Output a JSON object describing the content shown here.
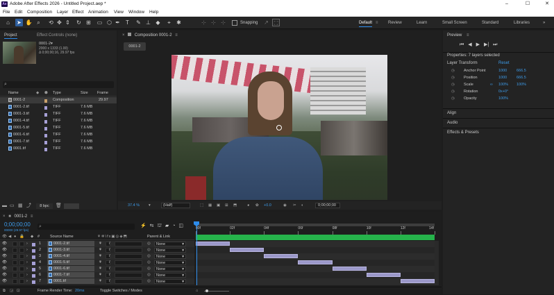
{
  "app": {
    "title": "Adobe After Effects 2026 - Untitled Project.aep *",
    "icon_text": "Ae"
  },
  "window_controls": {
    "minimize": "–",
    "maximize": "☐",
    "close": "✕"
  },
  "menu": [
    "File",
    "Edit",
    "Composition",
    "Layer",
    "Effect",
    "Animation",
    "View",
    "Window",
    "Help"
  ],
  "toolbar": {
    "snapping": "Snapping"
  },
  "workspaces": [
    "Default",
    "Review",
    "Learn",
    "Small Screen",
    "Standard",
    "Libraries"
  ],
  "project_panel": {
    "tab_project": "Project",
    "tab_effects": "Effect Controls (none)",
    "comp_name": "0001-2▾",
    "comp_size": "2000 x 1333 (1.00)",
    "comp_duration": "Δ 0;00;00;16, 29.97 fps",
    "search_placeholder": "",
    "columns": {
      "name": "Name",
      "type": "Type",
      "size": "Size",
      "frame_rate": "Frame Ra..."
    },
    "items": [
      {
        "name": "0001-2",
        "type": "Composition",
        "size": "",
        "fps": "29.97",
        "kind": "comp",
        "label_color": "#c9a06b"
      },
      {
        "name": "0001-2.tif",
        "type": "TIFF",
        "size": "7.6 MB",
        "fps": "",
        "kind": "file",
        "label_color": "#a6a0d6"
      },
      {
        "name": "0001-3.tif",
        "type": "TIFF",
        "size": "7.6 MB",
        "fps": "",
        "kind": "file",
        "label_color": "#a6a0d6"
      },
      {
        "name": "0001-4.tif",
        "type": "TIFF",
        "size": "7.6 MB",
        "fps": "",
        "kind": "file",
        "label_color": "#a6a0d6"
      },
      {
        "name": "0001-5.tif",
        "type": "TIFF",
        "size": "7.6 MB",
        "fps": "",
        "kind": "file",
        "label_color": "#a6a0d6"
      },
      {
        "name": "0001-6.tif",
        "type": "TIFF",
        "size": "7.6 MB",
        "fps": "",
        "kind": "file",
        "label_color": "#a6a0d6"
      },
      {
        "name": "0001-7.tif",
        "type": "TIFF",
        "size": "7.6 MB",
        "fps": "",
        "kind": "file",
        "label_color": "#a6a0d6"
      },
      {
        "name": "0001.tif",
        "type": "TIFF",
        "size": "7.6 MB",
        "fps": "",
        "kind": "file",
        "label_color": "#a6a0d6"
      }
    ],
    "bpc": "8 bpc"
  },
  "comp_viewer": {
    "tab": "Composition 0001-2",
    "subtab": "0001-2",
    "zoom": "37.4 %",
    "resolution": "(Half)",
    "exposure": "+0.0",
    "timecode": "0;00;00;00"
  },
  "right_panel": {
    "preview_title": "Preview",
    "properties_title": "Properties: 7 layers selected",
    "layer_transform": "Layer Transform",
    "reset": "Reset",
    "props": [
      {
        "name": "Anchor Point",
        "v1": "1000",
        "v2": "666.5",
        "link": false
      },
      {
        "name": "Position",
        "v1": "1000",
        "v2": "666.5",
        "link": false
      },
      {
        "name": "Scale",
        "v1": "100%",
        "v2": "100%",
        "link": true
      },
      {
        "name": "Rotation",
        "v1": "0x+0°",
        "v2": "",
        "link": false
      },
      {
        "name": "Opacity",
        "v1": "100%",
        "v2": "",
        "link": false
      }
    ],
    "sections": [
      "Align",
      "Audio",
      "Effects & Presets"
    ]
  },
  "timeline": {
    "tab": "0001-2",
    "timecode": "0;00;00;00",
    "timecode_sub": "00000 (29.97 fps)",
    "col_hash": "#",
    "col_source": "Source Name",
    "col_parent": "Parent & Link",
    "ruler": [
      "00f",
      "02f",
      "04f",
      "06f",
      "08f",
      "10f",
      "12f",
      "14f"
    ],
    "layers": [
      {
        "num": "1",
        "name": "0001-2.tif",
        "parent": "None",
        "bar_start": 0,
        "bar_end": 2
      },
      {
        "num": "2",
        "name": "0001-3.tif",
        "parent": "None",
        "bar_start": 2,
        "bar_end": 4
      },
      {
        "num": "3",
        "name": "0001-4.tif",
        "parent": "None",
        "bar_start": 4,
        "bar_end": 6
      },
      {
        "num": "4",
        "name": "0001-5.tif",
        "parent": "None",
        "bar_start": 6,
        "bar_end": 8
      },
      {
        "num": "5",
        "name": "0001-6.tif",
        "parent": "None",
        "bar_start": 8,
        "bar_end": 10
      },
      {
        "num": "6",
        "name": "0001-7.tif",
        "parent": "None",
        "bar_start": 10,
        "bar_end": 12
      },
      {
        "num": "7",
        "name": "0001.tif",
        "parent": "None",
        "bar_start": 12,
        "bar_end": 14
      }
    ],
    "total_frames": 14,
    "footer_render_label": "Frame Render Time:",
    "footer_render_value": "20ms",
    "footer_toggle": "Toggle Switches / Modes"
  },
  "colors": {
    "accent": "#2d8ceb",
    "blue_value": "#3d9be9",
    "layer_bar": "#9b98c9",
    "work_area": "#26b34b"
  },
  "icons": [
    "home-icon",
    "selection-arrow-icon",
    "hand-icon",
    "zoom-icon",
    "rotate-icon",
    "camera-icon",
    "pan-icon",
    "rectangle-icon",
    "pen-icon",
    "type-icon",
    "brush-icon",
    "clone-icon",
    "eraser-icon",
    "roto-icon",
    "puppet-icon"
  ]
}
